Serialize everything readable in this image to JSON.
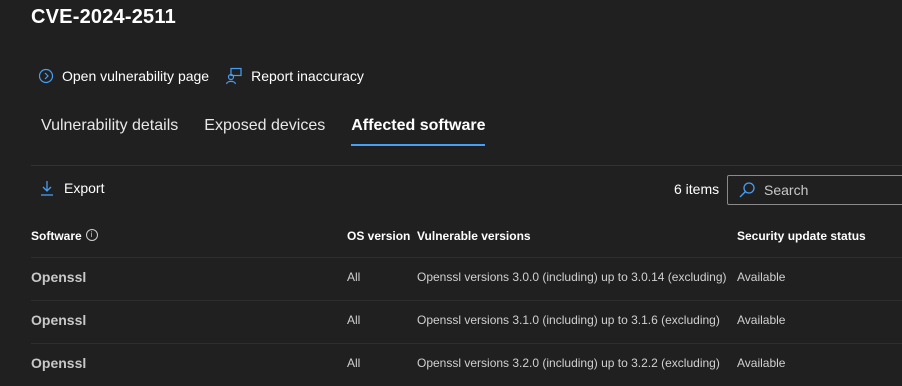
{
  "header": {
    "title": "CVE-2024-2511"
  },
  "actions": [
    {
      "icon": "chevron-right-circle-icon",
      "label": "Open vulnerability page"
    },
    {
      "icon": "person-feedback-icon",
      "label": "Report inaccuracy"
    }
  ],
  "tabs": [
    {
      "label": "Vulnerability details",
      "active": false
    },
    {
      "label": "Exposed devices",
      "active": false
    },
    {
      "label": "Affected software",
      "active": true
    }
  ],
  "toolbar": {
    "export_label": "Export",
    "item_count": "6 items",
    "search_placeholder": "Search"
  },
  "table": {
    "columns": [
      "Software",
      "OS version",
      "Vulnerable versions",
      "Security update status"
    ],
    "rows": [
      {
        "software": "Openssl",
        "os": "All",
        "versions": "Openssl versions 3.0.0 (including) up to 3.0.14 (excluding)",
        "status": "Available"
      },
      {
        "software": "Openssl",
        "os": "All",
        "versions": "Openssl versions 3.1.0 (including) up to 3.1.6 (excluding)",
        "status": "Available"
      },
      {
        "software": "Openssl",
        "os": "All",
        "versions": "Openssl versions 3.2.0 (including) up to 3.2.2 (excluding)",
        "status": "Available"
      }
    ]
  },
  "colors": {
    "background": "#202020",
    "accent": "#479ef5",
    "text": "#ffffff"
  }
}
